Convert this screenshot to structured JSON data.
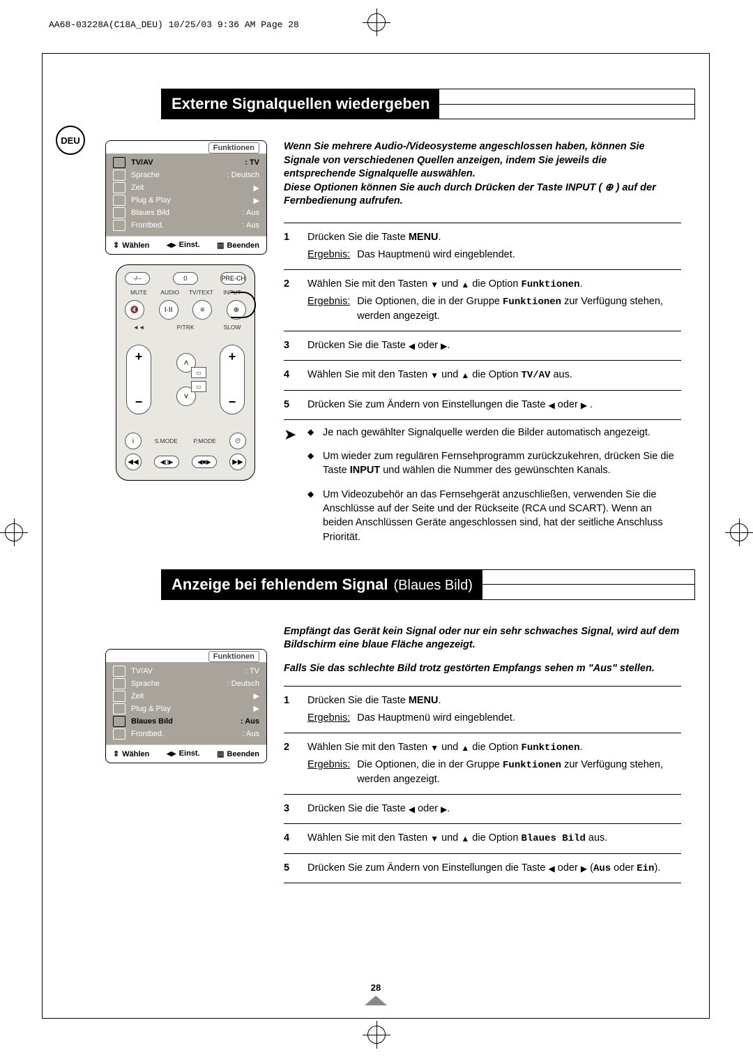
{
  "print_header": "AA68-03228A(C18A_DEU)  10/25/03  9:36 AM  Page 28",
  "lang_badge": "DEU",
  "page_number": "28",
  "section1": {
    "title": "Externe Signalquellen wiedergeben",
    "intro": "Wenn Sie mehrere Audio-/Videosysteme angeschlossen haben, können Sie Signale von verschiedenen Quellen anzeigen, indem Sie jeweils die entsprechende Signalquelle auswählen.\nDiese Optionen können Sie auch durch Drücken der Taste INPUT ( ⊕ ) auf der Fernbedienung aufrufen.",
    "osd": {
      "head": "Funktionen",
      "rows": [
        {
          "label": "TV/AV",
          "value": "TV",
          "hl": true
        },
        {
          "label": "Sprache",
          "value": "Deutsch",
          "hl": false
        },
        {
          "label": "Zeit",
          "value": "▶",
          "hl": false,
          "arrow": true
        },
        {
          "label": "Plug & Play",
          "value": "▶",
          "hl": false,
          "arrow": true
        },
        {
          "label": "Blaues Bild",
          "value": "Aus",
          "hl": false
        },
        {
          "label": "Frontbed.",
          "value": "Aus",
          "hl": false
        }
      ],
      "foot": {
        "f1": "Wählen",
        "f2": "Einst.",
        "f3": "Beenden"
      }
    },
    "remote": {
      "r1": {
        "a": "-/--",
        "b": "0",
        "c": "PRE-CH"
      },
      "labels": {
        "mute": "MUTE",
        "audio": "AUDIO",
        "tvtext": "TV/TEXT",
        "input": "INPUT"
      },
      "mid": {
        "l": "◄◄",
        "slow": "SLOW",
        "ptrk": "P/TRK"
      },
      "bot": {
        "a": "",
        "smode": "S.MODE",
        "pmode": "P.MODE"
      }
    },
    "steps": [
      {
        "n": "1",
        "html": "Drücken Sie die Taste <b>MENU</b>.",
        "result": "Das Hauptmenü wird eingeblendet."
      },
      {
        "n": "2",
        "html": "Wählen Sie mit den Tasten <span class='tri'>▼</span> und <span class='tri'>▲</span> die Option <span class='mono'>Funktionen</span>.",
        "result_html": "Die Optionen, die in der Gruppe <span class='mono'>Funktionen</span> zur Verfügung stehen, werden angezeigt."
      },
      {
        "n": "3",
        "html": "Drücken Sie die Taste <span class='tri'>◀</span> oder <span class='tri'>▶</span>."
      },
      {
        "n": "4",
        "html": "Wählen Sie mit den Tasten <span class='tri'>▼</span> und <span class='tri'>▲</span> die Option <span class='mono'>TV/AV</span> aus."
      },
      {
        "n": "5",
        "html": "Drücken Sie zum Ändern von Einstellungen die Taste <span class='tri'>◀</span> oder <span class='tri'>▶</span> ."
      }
    ],
    "notes": [
      "Je nach gewählter Signalquelle werden die Bilder automatisch angezeigt.",
      "Um wieder zum regulären Fernsehprogramm zurückzukehren, drücken Sie die Taste <b>INPUT</b> und wählen die Nummer des gewünschten Kanals.",
      "Um Videozubehör an das Fernsehgerät anzuschließen, verwenden Sie die Anschlüsse auf der Seite und der Rückseite (RCA und SCART). Wenn an beiden Anschlüssen Geräte angeschlossen sind, hat der seitliche Anschluss Priorität."
    ],
    "result_label": "Ergebnis:"
  },
  "section2": {
    "title": "Anzeige bei fehlendem Signal",
    "title_sub": "(Blaues Bild)",
    "intro1": "Empfängt das Gerät kein Signal oder nur ein sehr schwaches Signal, wird auf dem Bildschirm eine blaue Fläche angezeigt.",
    "intro2": "Falls Sie das schlechte Bild trotz gestörten Empfangs sehen m \"Aus\" stellen.",
    "osd": {
      "head": "Funktionen",
      "rows": [
        {
          "label": "TV/AV",
          "value": "TV",
          "hl": false
        },
        {
          "label": "Sprache",
          "value": "Deutsch",
          "hl": false
        },
        {
          "label": "Zeit",
          "value": "▶",
          "hl": false,
          "arrow": true
        },
        {
          "label": "Plug & Play",
          "value": "▶",
          "hl": false,
          "arrow": true
        },
        {
          "label": "Blaues Bild",
          "value": "Aus",
          "hl": true
        },
        {
          "label": "Frontbed.",
          "value": "Aus",
          "hl": false
        }
      ],
      "foot": {
        "f1": "Wählen",
        "f2": "Einst.",
        "f3": "Beenden"
      }
    },
    "steps": [
      {
        "n": "1",
        "html": "Drücken Sie die Taste <b>MENU</b>.",
        "result": "Das Hauptmenü wird eingeblendet."
      },
      {
        "n": "2",
        "html": "Wählen Sie mit den Tasten <span class='tri'>▼</span> und <span class='tri'>▲</span> die Option <span class='mono'>Funktionen</span>.",
        "result_html": "Die Optionen, die in der Gruppe <span class='mono'>Funktionen</span> zur Verfügung stehen, werden angezeigt."
      },
      {
        "n": "3",
        "html": "Drücken Sie die Taste <span class='tri'>◀</span> oder <span class='tri'>▶</span>."
      },
      {
        "n": "4",
        "html": "Wählen Sie mit den Tasten <span class='tri'>▼</span> und <span class='tri'>▲</span> die Option <span class='mono'>Blaues Bild</span> aus."
      },
      {
        "n": "5",
        "html": "Drücken Sie zum Ändern von Einstellungen die Taste <span class='tri'>◀</span> oder <span class='tri'>▶</span> (<span class='mono'>Aus</span> oder <span class='mono'>Ein</span>)."
      }
    ],
    "result_label": "Ergebnis:"
  }
}
